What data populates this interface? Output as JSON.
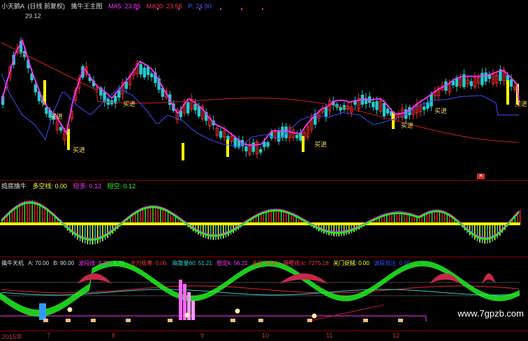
{
  "colors": {
    "bg": "#000000",
    "border": "#8b0000",
    "up": "#ff3030",
    "down": "#22cccc",
    "ma5": "#ff33ff",
    "ma30": "#3a4cff",
    "ma60": "#cc2020",
    "yellow": "#ffff00",
    "green": "#22ee22",
    "red": "#ee2233",
    "cyan": "#33cccc"
  },
  "main_panel": {
    "title": "小天鹅A",
    "period": "(日线 前复权)",
    "indicator": "擒牛王主图",
    "ma5_label": "MA5: 23.85",
    "ma30_label": "MA30: 23.56",
    "extra_label": "P: 24.90",
    "high_price": "29.12",
    "buy_label": "买进",
    "corner_icon": "close-box-icon"
  },
  "mid_panel": {
    "title": "捣底擒牛",
    "item1": "多空线: 0.00",
    "item2": "短多: 0.12",
    "item3": "短空: 0.12"
  },
  "bottom_panel": {
    "title": "擒牛天机",
    "a": "A: 70.00",
    "b": "B: 90.00",
    "c1": "波段线: 8.79",
    "c2": "8.79",
    "c3": "主力吸筹: 0.00",
    "c4": "高散量60: 51.21",
    "c5": "稳定k: 56.21",
    "c6": "主升: 0.00",
    "c7": "隔壁观火: 7275.18",
    "c8": "关门捉贼: 0.00",
    "c9": "波段观注: 0.00"
  },
  "x_axis": [
    "2015年",
    "7",
    "8",
    "9",
    "10",
    "11",
    "12"
  ],
  "watermark": "www.7gpzb.com"
}
